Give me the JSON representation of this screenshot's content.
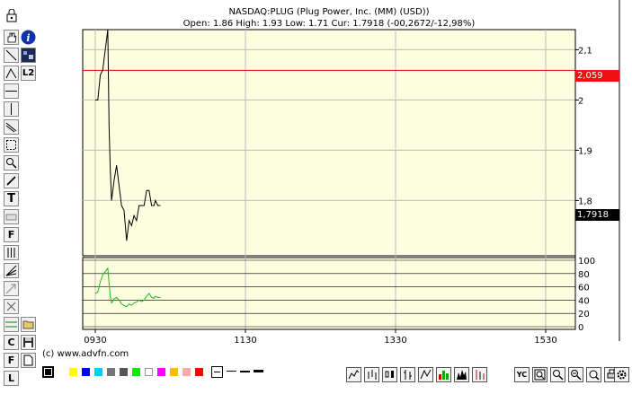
{
  "chart_header": {
    "title": "NASDAQ:PLUG (Plug Power, Inc. (MM) (USD))",
    "ohlc": "Open: 1.86 High: 1.93 Low: 1.71 Cur: 1.7918 (-00,2672/-12,98%)"
  },
  "price_tags": {
    "reference_line": "2,059",
    "current_price": "1,7918"
  },
  "colors": {
    "panel_bg": "#fdfde0",
    "grid": "#bdbdbd",
    "price_line": "#000000",
    "reference_line": "#dd0000",
    "reference_tag_bg": "#ee1111",
    "current_tag_bg": "#000000",
    "oscillator_line": "#22bb22"
  },
  "chart_data": [
    {
      "type": "line",
      "name": "price",
      "y_ticks": [
        "2,1",
        "2",
        "1,9",
        "1,8"
      ],
      "ylim": [
        1.69,
        2.14
      ],
      "x_ticks": [
        "0930",
        "1130",
        "1330",
        "1530"
      ],
      "reference_value": 2.059,
      "current_value": 1.7918,
      "x": [
        0,
        2,
        4,
        6,
        8,
        10,
        11,
        12,
        13,
        14,
        15,
        17,
        19,
        21,
        23,
        25,
        27,
        29,
        31,
        33,
        35,
        37,
        39,
        41,
        43,
        45,
        47,
        48,
        50,
        52
      ],
      "values": [
        2.0,
        2.0,
        2.05,
        2.06,
        2.1,
        2.14,
        1.95,
        1.86,
        1.8,
        1.82,
        1.84,
        1.87,
        1.83,
        1.79,
        1.78,
        1.72,
        1.76,
        1.75,
        1.77,
        1.76,
        1.79,
        1.79,
        1.79,
        1.82,
        1.82,
        1.79,
        1.79,
        1.8,
        1.79,
        1.79
      ]
    },
    {
      "type": "line",
      "name": "oscillator",
      "y_ticks": [
        "100",
        "80",
        "60",
        "40",
        "20",
        "0"
      ],
      "ylim": [
        0,
        100
      ],
      "x": [
        0,
        2,
        4,
        6,
        8,
        10,
        11,
        12,
        13,
        14,
        15,
        17,
        19,
        21,
        23,
        25,
        27,
        29,
        31,
        33,
        35,
        37,
        39,
        41,
        43,
        45,
        47,
        48,
        50,
        52
      ],
      "values": [
        50,
        52,
        68,
        78,
        83,
        88,
        66,
        45,
        36,
        38,
        42,
        44,
        40,
        34,
        32,
        30,
        34,
        32,
        36,
        37,
        40,
        38,
        40,
        46,
        50,
        44,
        43,
        46,
        44,
        44
      ]
    }
  ],
  "toolbar_left": {
    "items": [
      "lock-icon",
      "hand-pan-icon",
      "info-icon",
      "line-tool-icon",
      "ticker-image-icon",
      "angle-tool-icon",
      "l2-label",
      "horizontal-line-icon",
      "vertical-line-icon",
      "diagonal-line-icon",
      "rectangle-select-icon",
      "zoom-tool-icon",
      "pen-tool-icon",
      "text-tool-icon",
      "eraser-icon",
      "fibonacci-icon",
      "vertical-bars-icon",
      "fan-tool-icon",
      "arrow-tool-icon",
      "delete-tool-icon",
      "indicator-icon",
      "folder-open-icon",
      "c-tool-icon",
      "save-icon",
      "f-tool-icon",
      "new-doc-icon",
      "l-tool-icon"
    ],
    "l2_label": "L2",
    "text_tool_label": "T",
    "f_label": "F",
    "c_label": "C",
    "l_label": "L"
  },
  "copyright": "(c) www.advfn.com",
  "palette": {
    "swatches": [
      "#000000",
      "#ffff00",
      "#0000ff",
      "#00ccff",
      "#777777",
      "#555555",
      "#00ee00",
      "#ff00ff",
      "#ffbb00",
      "#ffaaaa",
      "#ff0000"
    ]
  },
  "bottom_toolbar": {
    "buttons": [
      "line-chart-type",
      "bar-chart-type",
      "candle-chart-type",
      "ohlc-chart-type",
      "mountain-chart-type",
      "volume-chart-type",
      "histogram-chart-type",
      "point-figure-chart-type",
      "yc-button",
      "zoom-in-button",
      "zoom-button",
      "zoom-out-button",
      "search-button",
      "print-button",
      "settings-button"
    ],
    "yc_label": "YC"
  }
}
